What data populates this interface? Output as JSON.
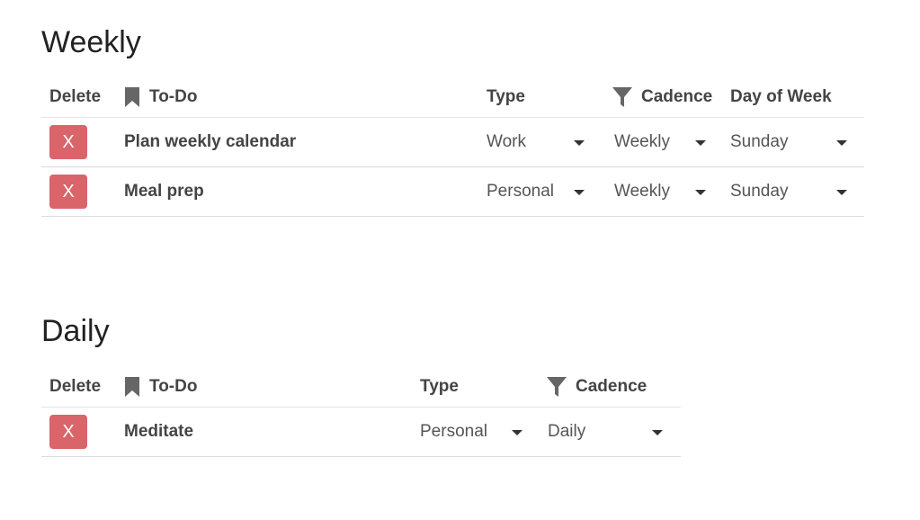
{
  "weekly": {
    "title": "Weekly",
    "headers": {
      "delete": "Delete",
      "todo": "To-Do",
      "type": "Type",
      "cadence": "Cadence",
      "day_of_week": "Day of Week"
    },
    "rows": [
      {
        "delete_label": "X",
        "todo": "Plan weekly calendar",
        "type": "Work",
        "cadence": "Weekly",
        "day": "Sunday"
      },
      {
        "delete_label": "X",
        "todo": "Meal prep",
        "type": "Personal",
        "cadence": "Weekly",
        "day": "Sunday"
      }
    ]
  },
  "daily": {
    "title": "Daily",
    "headers": {
      "delete": "Delete",
      "todo": "To-Do",
      "type": "Type",
      "cadence": "Cadence"
    },
    "rows": [
      {
        "delete_label": "X",
        "todo": "Meditate",
        "type": "Personal",
        "cadence": "Daily"
      }
    ]
  },
  "icons": {
    "todo_header": "bookmark-icon",
    "cadence_header": "filter-icon",
    "dropdown": "caret-down-icon"
  },
  "colors": {
    "delete_button": "#d9646a",
    "text": "#444444",
    "title": "#222222",
    "divider": "#dcdcdc"
  }
}
